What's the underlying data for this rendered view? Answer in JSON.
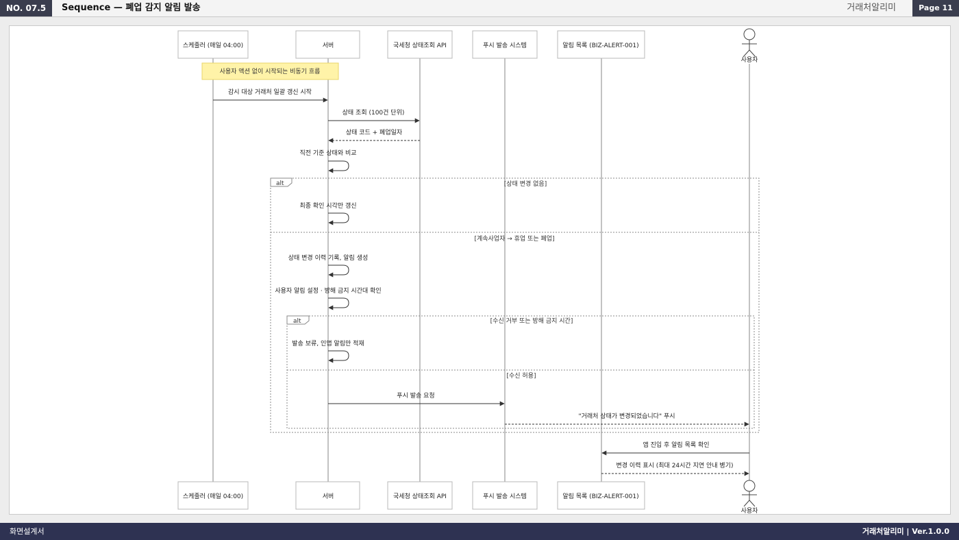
{
  "header": {
    "doc_no": "NO. 07.5",
    "title": "Sequence — 폐업 감지 알림 발송",
    "brand": "거래처알리미",
    "page": "Page 11"
  },
  "footer": {
    "left": "화면설계서",
    "right": "거래처알리미 | Ver.1.0.0"
  },
  "diagram": {
    "participants": [
      "스케줄러 (매일 04:00)",
      "서버",
      "국세청 상태조회 API",
      "푸시 발송 시스템",
      "알림 목록 (BIZ-ALERT-001)"
    ],
    "actor": "사용자",
    "note": "사용자 액션 없이 시작되는 비동기 흐름",
    "messages": [
      "감시 대상 거래처 일괄 갱신 시작",
      "상태 조회 (100건 단위)",
      "상태 코드 + 폐업일자",
      "직전 기준 상태와 비교",
      "최종 확인 시각만 갱신",
      "상태 변경 이력 기록, 알림 생성",
      "사용자 알림 설정 · 방해 금지 시간대 확인",
      "발송 보류, 인앱 알림만 적재",
      "푸시 발송 요청",
      "\"거래처 상태가 변경되었습니다\" 푸시",
      "앱 진입 후 알림 목록 확인",
      "변경 이력 표시 (최대 24시간 지연 안내 병기)"
    ],
    "alt_label": "alt",
    "guards": [
      "[상태 변경 없음]",
      "[계속사업자 → 휴업 또는 폐업]",
      "[수신 거부 또는 방해 금지 시간]",
      "[수신 허용]"
    ],
    "colors": {
      "note_bg": "#fff3a8",
      "note_border": "#e8d66a",
      "line": "#555555",
      "box_border": "#b8b8b8"
    }
  }
}
